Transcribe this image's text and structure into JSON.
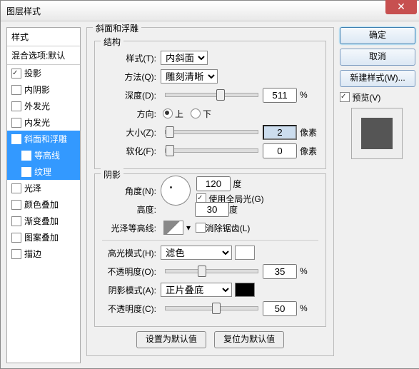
{
  "title": "图层样式",
  "sidebar": {
    "header": "样式",
    "blend": "混合选项:默认",
    "items": [
      {
        "label": "投影",
        "checked": true
      },
      {
        "label": "内阴影",
        "checked": false
      },
      {
        "label": "外发光",
        "checked": false
      },
      {
        "label": "内发光",
        "checked": false
      },
      {
        "label": "斜面和浮雕",
        "checked": true,
        "selected": true
      },
      {
        "label": "等高线",
        "checked": false,
        "sub": true,
        "selected": true
      },
      {
        "label": "纹理",
        "checked": false,
        "sub": true,
        "selected": true
      },
      {
        "label": "光泽",
        "checked": false
      },
      {
        "label": "颜色叠加",
        "checked": false
      },
      {
        "label": "渐变叠加",
        "checked": false
      },
      {
        "label": "图案叠加",
        "checked": false
      },
      {
        "label": "描边",
        "checked": false
      }
    ]
  },
  "panel": {
    "title": "斜面和浮雕",
    "struct": {
      "title": "结构",
      "style_l": "样式(T):",
      "style_v": "内斜面",
      "tech_l": "方法(Q):",
      "tech_v": "雕刻清晰",
      "depth_l": "深度(D):",
      "depth_v": "511",
      "pct": "%",
      "dir_l": "方向:",
      "up": "上",
      "down": "下",
      "size_l": "大小(Z):",
      "size_v": "2",
      "px": "像素",
      "soft_l": "软化(F):",
      "soft_v": "0"
    },
    "shade": {
      "title": "阴影",
      "angle_l": "角度(N):",
      "angle_v": "120",
      "deg": "度",
      "global": "使用全局光(G)",
      "alt_l": "高度:",
      "alt_v": "30",
      "gloss_l": "光泽等高线:",
      "anti": "消除锯齿(L)",
      "hl_l": "高光模式(H):",
      "hl_v": "滤色",
      "hlop_l": "不透明度(O):",
      "hlop_v": "35",
      "sh_l": "阴影模式(A):",
      "sh_v": "正片叠底",
      "shop_l": "不透明度(C):",
      "shop_v": "50"
    },
    "defaults": "设置为默认值",
    "reset": "复位为默认值"
  },
  "right": {
    "ok": "确定",
    "cancel": "取消",
    "newstyle": "新建样式(W)...",
    "preview": "预览(V)"
  }
}
